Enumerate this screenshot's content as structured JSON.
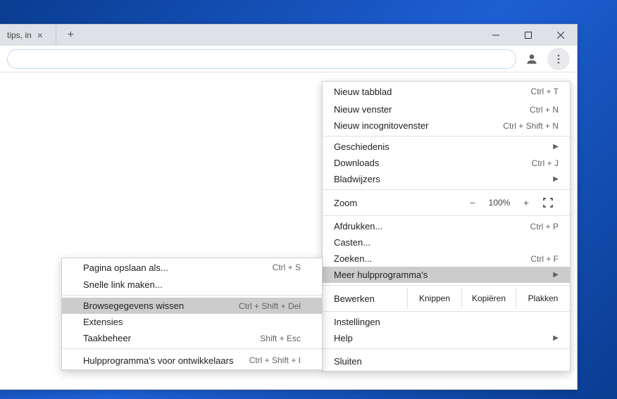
{
  "tab": {
    "title": "tips, in",
    "close": "×"
  },
  "window_controls": {
    "min": "—",
    "max": "☐",
    "close": "✕"
  },
  "menu": {
    "new_tab": {
      "label": "Nieuw tabblad",
      "shortcut": "Ctrl + T"
    },
    "new_window": {
      "label": "Nieuw venster",
      "shortcut": "Ctrl + N"
    },
    "incognito": {
      "label": "Nieuw incognitovenster",
      "shortcut": "Ctrl + Shift + N"
    },
    "history": {
      "label": "Geschiedenis"
    },
    "downloads": {
      "label": "Downloads",
      "shortcut": "Ctrl + J"
    },
    "bookmarks": {
      "label": "Bladwijzers"
    },
    "zoom": {
      "label": "Zoom",
      "minus": "−",
      "value": "100%",
      "plus": "+"
    },
    "print": {
      "label": "Afdrukken...",
      "shortcut": "Ctrl + P"
    },
    "cast": {
      "label": "Casten..."
    },
    "find": {
      "label": "Zoeken...",
      "shortcut": "Ctrl + F"
    },
    "more_tools": {
      "label": "Meer hulpprogramma's"
    },
    "edit": {
      "label": "Bewerken",
      "cut": "Knippen",
      "copy": "Kopiëren",
      "paste": "Plakken"
    },
    "settings": {
      "label": "Instellingen"
    },
    "help": {
      "label": "Help"
    },
    "exit": {
      "label": "Sluiten"
    }
  },
  "submenu": {
    "save_page": {
      "label": "Pagina opslaan als...",
      "shortcut": "Ctrl + S"
    },
    "shortcut": {
      "label": "Snelle link maken..."
    },
    "clear_data": {
      "label": "Browsegegevens wissen",
      "shortcut": "Ctrl + Shift + Del"
    },
    "extensions": {
      "label": "Extensies"
    },
    "task_manager": {
      "label": "Taakbeheer",
      "shortcut": "Shift + Esc"
    },
    "dev_tools": {
      "label": "Hulpprogramma's voor ontwikkelaars",
      "shortcut": "Ctrl + Shift + I"
    }
  }
}
